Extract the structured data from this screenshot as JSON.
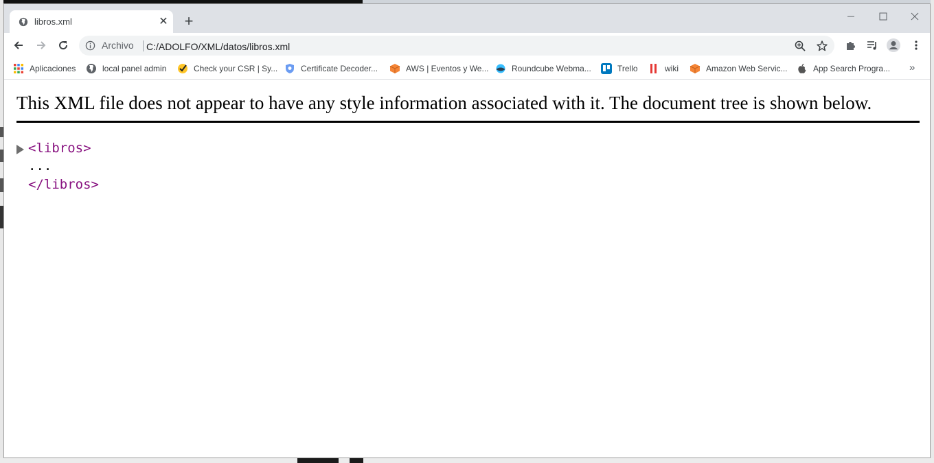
{
  "browser": {
    "tab": {
      "title": "libros.xml"
    },
    "new_tab_label": "+",
    "window_controls": {
      "minimize": "–",
      "maximize": "☐",
      "close": "✕"
    },
    "address_bar": {
      "chip": "Archivo",
      "url": "C:/ADOLFO/XML/datos/libros.xml"
    },
    "bookmarks": [
      {
        "label": "Aplicaciones",
        "icon": "apps-grid-icon"
      },
      {
        "label": "local panel admin",
        "icon": "globe-icon"
      },
      {
        "label": "Check your CSR | Sy...",
        "icon": "norton-check-icon"
      },
      {
        "label": "Certificate Decoder...",
        "icon": "shield-icon"
      },
      {
        "label": "AWS | Eventos y We...",
        "icon": "aws-cube-icon"
      },
      {
        "label": "Roundcube Webma...",
        "icon": "roundcube-icon"
      },
      {
        "label": "Trello",
        "icon": "trello-icon"
      },
      {
        "label": "wiki",
        "icon": "wiki-icon"
      },
      {
        "label": "Amazon Web Servic...",
        "icon": "aws-cube-icon"
      },
      {
        "label": "App Search Progra...",
        "icon": "apple-icon"
      }
    ],
    "bookmarks_more": "»"
  },
  "page": {
    "message": "This XML file does not appear to have any style information associated with it. The document tree is shown below.",
    "tree": {
      "open_tag": "<libros>",
      "ellipsis": "...",
      "close_tag": "</libros>"
    }
  },
  "colors": {
    "tag": "#881280",
    "tabstrip": "#dee1e6",
    "omnibox": "#f1f3f4"
  }
}
